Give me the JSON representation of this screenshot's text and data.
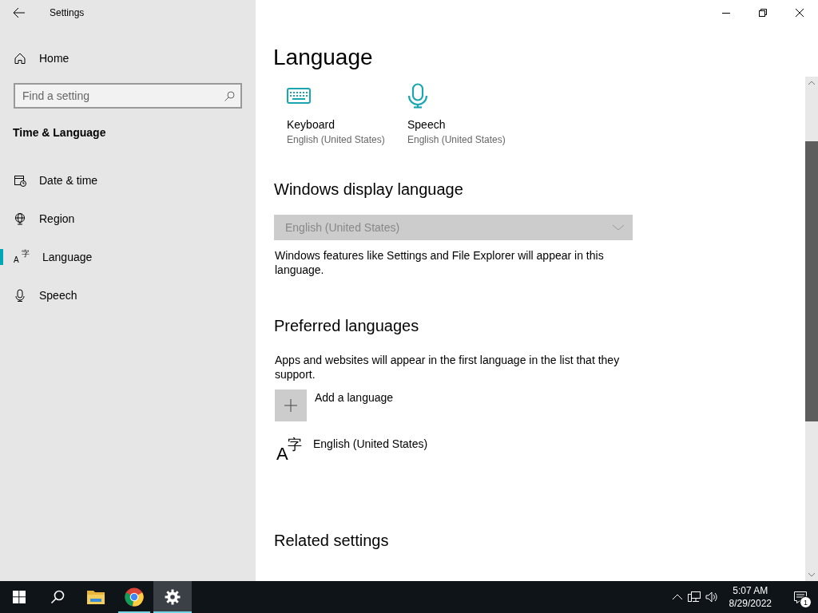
{
  "window": {
    "title": "Settings"
  },
  "sidebar": {
    "home": "Home",
    "search": {
      "placeholder": "Find a setting"
    },
    "category": "Time & Language",
    "items": [
      {
        "label": "Date & time",
        "kind": "calendar",
        "selected": false
      },
      {
        "label": "Region",
        "kind": "globe",
        "selected": false
      },
      {
        "label": "Language",
        "kind": "language",
        "selected": true
      },
      {
        "label": "Speech",
        "kind": "mic",
        "selected": false
      }
    ]
  },
  "page": {
    "title": "Language",
    "tiles": [
      {
        "label": "Keyboard",
        "value": "English (United States)",
        "kind": "keyboard"
      },
      {
        "label": "Speech",
        "value": "English (United States)",
        "kind": "mic"
      }
    ],
    "display_language": {
      "heading": "Windows display language",
      "dropdown": {
        "value": "English (United States)",
        "disabled": true
      },
      "description": "Windows features like Settings and File Explorer will appear in this language."
    },
    "preferred": {
      "heading": "Preferred languages",
      "description": "Apps and websites will appear in the first language in the list that they support.",
      "add_label": "Add a language",
      "languages": [
        {
          "name": "English (United States)",
          "glyph_latin": "A",
          "glyph_cjk": "字"
        }
      ]
    },
    "related_heading": "Related settings"
  },
  "taskbar": {
    "apps": [
      {
        "kind": "start",
        "running": false,
        "selected": false
      },
      {
        "kind": "search",
        "running": false,
        "selected": false
      },
      {
        "kind": "explorer",
        "running": false,
        "selected": false
      },
      {
        "kind": "chrome",
        "running": true,
        "selected": false
      },
      {
        "kind": "settings",
        "running": true,
        "selected": true
      }
    ],
    "time": "5:07 AM",
    "date": "8/29/2022",
    "notifications": "1"
  },
  "sidebar_glyph": {
    "latin": "A",
    "cjk": "字"
  }
}
